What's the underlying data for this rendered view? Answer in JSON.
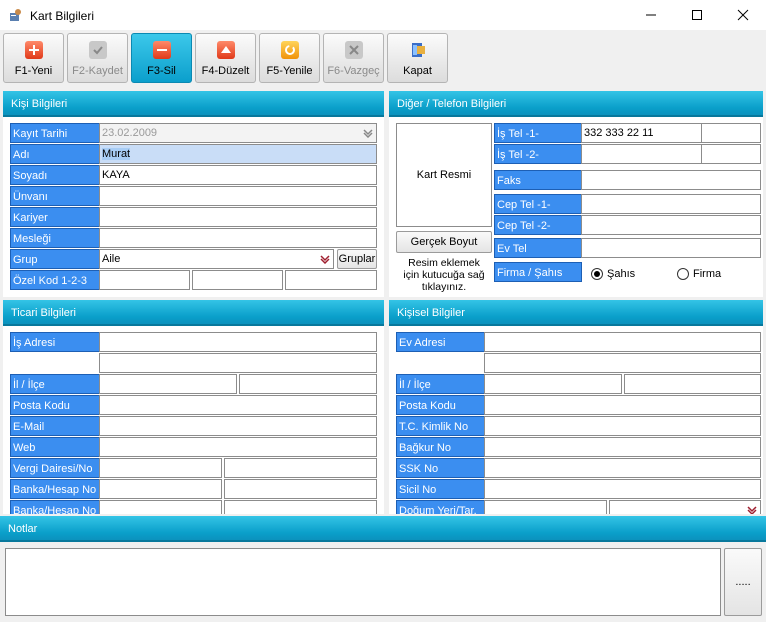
{
  "window": {
    "title": "Kart Bilgileri"
  },
  "toolbar": [
    {
      "label": "F1-Yeni",
      "icon": "plus-icon",
      "state": "normal"
    },
    {
      "label": "F2-Kaydet",
      "icon": "check-icon",
      "state": "disabled"
    },
    {
      "label": "F3-Sil",
      "icon": "minus-icon",
      "state": "active"
    },
    {
      "label": "F4-Düzelt",
      "icon": "edit-icon",
      "state": "normal"
    },
    {
      "label": "F5-Yenile",
      "icon": "refresh-icon",
      "state": "normal"
    },
    {
      "label": "F6-Vazgeç",
      "icon": "cancel-icon",
      "state": "disabled"
    },
    {
      "label": "Kapat",
      "icon": "exit-icon",
      "state": "normal"
    }
  ],
  "kisi": {
    "header": "Kişi Bilgileri",
    "labels": [
      "Kayıt Tarihi",
      "Adı",
      "Soyadı",
      "Ünvanı",
      "Kariyer",
      "Mesleği",
      "Grup",
      "Özel Kod 1-2-3"
    ],
    "kayit_tarihi": "23.02.2009",
    "adi": "Murat",
    "soyadi": "KAYA",
    "grup": "Aile",
    "gruplar_button": "Gruplar"
  },
  "diger": {
    "header": "Diğer / Telefon Bilgileri",
    "kart_resmi": "Kart Resmi",
    "gercek_boyut": "Gerçek Boyut",
    "resim_hint": "Resim eklemek için kutucuğa sağ tıklayınız.",
    "labels": [
      "İş Tel -1-",
      "İş Tel -2-",
      "Faks",
      "Cep Tel -1-",
      "Cep Tel -2-",
      "Ev Tel",
      "Firma / Şahıs"
    ],
    "is_tel_1": "332 333 22 11",
    "radio_sahis": "Şahıs",
    "radio_firma": "Firma"
  },
  "ticari": {
    "header": "Ticari Bilgileri",
    "labels": [
      "İş Adresi",
      "İl / İlçe",
      "Posta Kodu",
      "E-Mail",
      "Web",
      "Vergi Dairesi/No",
      "Banka/Hesap No",
      "Banka/Hesap No"
    ]
  },
  "kisisel": {
    "header": "Kişisel Bilgiler",
    "labels": [
      "Ev Adresi",
      "İl / İlçe",
      "Posta Kodu",
      "T.C. Kimlik No",
      "Bağkur No",
      "SSK No",
      "Sicil No",
      "Doğum Yeri/Tar."
    ]
  },
  "notlar": {
    "header": "Notlar",
    "more_button": "....."
  },
  "colors": {
    "label_bg": "#3b8ef0",
    "header_bg": "#0a9fca"
  }
}
